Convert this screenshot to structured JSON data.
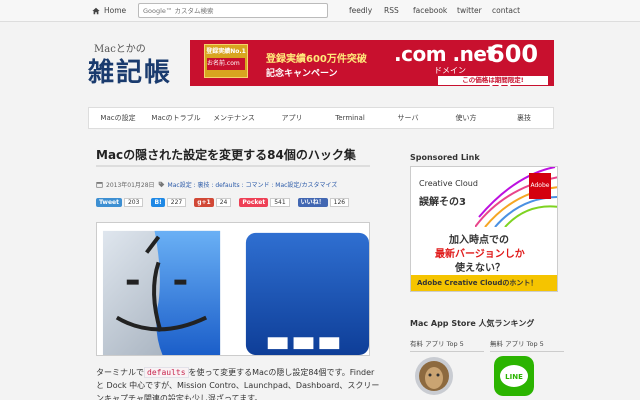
{
  "topbar": {
    "home_label": "Home",
    "search_placeholder": "Google™ カスタム検索",
    "links": [
      "feedly",
      "RSS",
      "facebook",
      "twitter",
      "contact"
    ]
  },
  "header": {
    "title_small": "Macとかの",
    "title_big": "雑記帳"
  },
  "banner": {
    "badge_text": "登録実績No.1",
    "badge_logo": "お名前.com",
    "line1": "登録実績600万件突破",
    "line2": "記念キャンペーン",
    "domain": ".com .net",
    "domain_jp": "ドメイン",
    "price": "600円",
    "limit": "この価格は期間限定!"
  },
  "nav": {
    "items": [
      "Macの設定",
      "Macのトラブル",
      "メンテナンス",
      "アプリ",
      "Terminal",
      "サーバ",
      "使い方",
      "裏技"
    ]
  },
  "post": {
    "title": "Macの隠された設定を変更する84個のハック集",
    "date": "2013年01月28日",
    "tags": "Mac設定 : 裏技 : defaults : コマンド : Mac設定/カスタマイズ",
    "social": [
      {
        "label": "Tweet",
        "count": "203",
        "color": "#3d8fd2"
      },
      {
        "label": "B!",
        "count": "227",
        "color": "#1e88e5"
      },
      {
        "label": "g+1",
        "count": "24",
        "color": "#d14836"
      },
      {
        "label": "Pocket",
        "count": "541",
        "color": "#ee4056"
      },
      {
        "label": "いいね！",
        "count": "126",
        "color": "#4267b2"
      }
    ],
    "body_pre": "ターミナルで",
    "body_code": "defaults",
    "body_post": "を使って変更するMacの隠し設定84個です。Finder と Dock 中心ですが、Mission Contro、Launchpad、Dashboard、スクリーンキャプチャ関連の設定も少し混ざってます。"
  },
  "sidebar": {
    "sponsored_heading": "Sponsored Link",
    "ad": {
      "brand": "Creative Cloud",
      "headline": "誤解その3",
      "pdf": "Adobe",
      "line1": "加入時点での",
      "line2": "最新バージョンしか",
      "line3": "使えない？",
      "footer": "Adobe Creative Cloudのホント！"
    },
    "ranking_heading": "Mac App Store 人気ランキング",
    "tabs": [
      "有料 アプリ Top 5",
      "無料 アプリ Top 5"
    ]
  },
  "colors": {
    "accent": "#1a3b6e",
    "banner_red": "#c8102e",
    "line_green": "#2bb400"
  }
}
